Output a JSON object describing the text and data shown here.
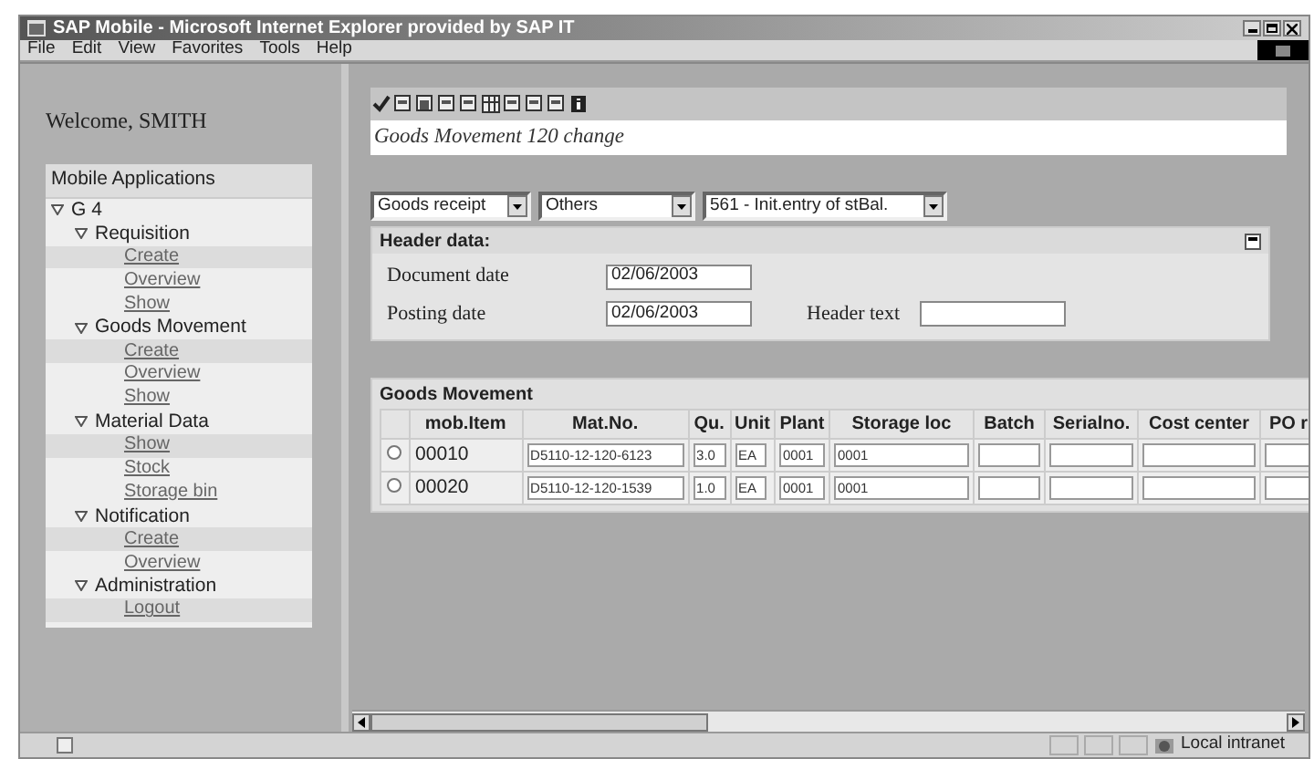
{
  "window": {
    "title": "SAP Mobile - Microsoft Internet Explorer provided by SAP IT"
  },
  "menu": [
    "File",
    "Edit",
    "View",
    "Favorites",
    "Tools",
    "Help"
  ],
  "welcome": "Welcome, SMITH",
  "nav": {
    "title": "Mobile Applications",
    "tree": [
      {
        "label": "G 4",
        "expanded": true,
        "children": [
          {
            "label": "Requisition",
            "expanded": true,
            "children": [
              {
                "label": "Create"
              },
              {
                "label": "Overview"
              },
              {
                "label": "Show"
              }
            ]
          },
          {
            "label": "Goods Movement",
            "expanded": true,
            "children": [
              {
                "label": "Create"
              },
              {
                "label": "Overview"
              },
              {
                "label": "Show"
              }
            ]
          },
          {
            "label": "Material Data",
            "expanded": true,
            "children": [
              {
                "label": "Show"
              },
              {
                "label": "Stock"
              },
              {
                "label": "Storage bin"
              }
            ]
          },
          {
            "label": "Notification",
            "expanded": true,
            "children": [
              {
                "label": "Create"
              },
              {
                "label": "Overview"
              }
            ]
          },
          {
            "label": "Administration",
            "expanded": true,
            "children": [
              {
                "label": "Logout"
              }
            ]
          }
        ]
      }
    ]
  },
  "page_title": "Goods Movement 120 change",
  "dropdowns": [
    "Goods receipt",
    "Others",
    "561 - Init.entry of stBal."
  ],
  "header": {
    "title": "Header data:",
    "fields": [
      {
        "label": "Document date",
        "value": "02/06/2003"
      },
      {
        "label": "Posting date",
        "value": "02/06/2003"
      },
      {
        "label": "Header text"
      }
    ]
  },
  "goods_movement": {
    "title": "Goods Movement",
    "columns": [
      "mob.Item",
      "Mat.No.",
      "Qu.",
      "Unit",
      "Plant",
      "Storage loc",
      "Batch",
      "Serialno.",
      "Cost center",
      "PO r"
    ],
    "rows": [
      {
        "selected": false,
        "cells": [
          "00010",
          "D5110-12-120-6123",
          "3.0",
          "EA",
          "0001",
          "0001"
        ]
      },
      {
        "selected": false,
        "cells": [
          "00020",
          "D5110-12-120-1539",
          "1.0",
          "EA",
          "0001",
          "0001"
        ]
      }
    ]
  },
  "status_bar": {
    "zone": "Local intranet"
  }
}
